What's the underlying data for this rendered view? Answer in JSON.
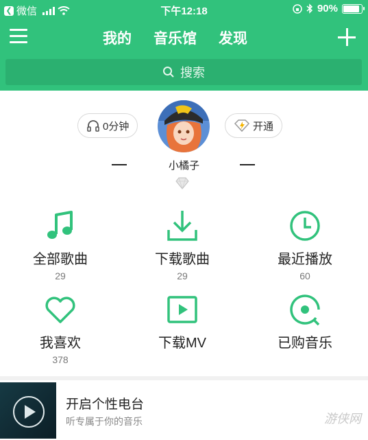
{
  "status_bar": {
    "back_app": "微信",
    "time": "下午12:18",
    "battery": "90%",
    "battery_level": 0.9
  },
  "nav": {
    "tabs": [
      "我的",
      "音乐馆",
      "发现"
    ]
  },
  "search": {
    "placeholder": "搜索"
  },
  "profile": {
    "listen_time": "0分钟",
    "vip_label": "开通",
    "username": "小橘子"
  },
  "grid": [
    {
      "label": "全部歌曲",
      "count": "29",
      "icon": "music-note-icon"
    },
    {
      "label": "下载歌曲",
      "count": "29",
      "icon": "download-icon"
    },
    {
      "label": "最近播放",
      "count": "60",
      "icon": "clock-icon"
    },
    {
      "label": "我喜欢",
      "count": "378",
      "icon": "heart-icon"
    },
    {
      "label": "下载MV",
      "count": "",
      "icon": "video-play-icon"
    },
    {
      "label": "已购音乐",
      "count": "",
      "icon": "purchased-disc-icon"
    }
  ],
  "radio": {
    "title": "开启个性电台",
    "subtitle": "听专属于你的音乐"
  },
  "watermark": "游侠网",
  "colors": {
    "brand": "#31c27c",
    "search_bg": "#2bb070"
  }
}
